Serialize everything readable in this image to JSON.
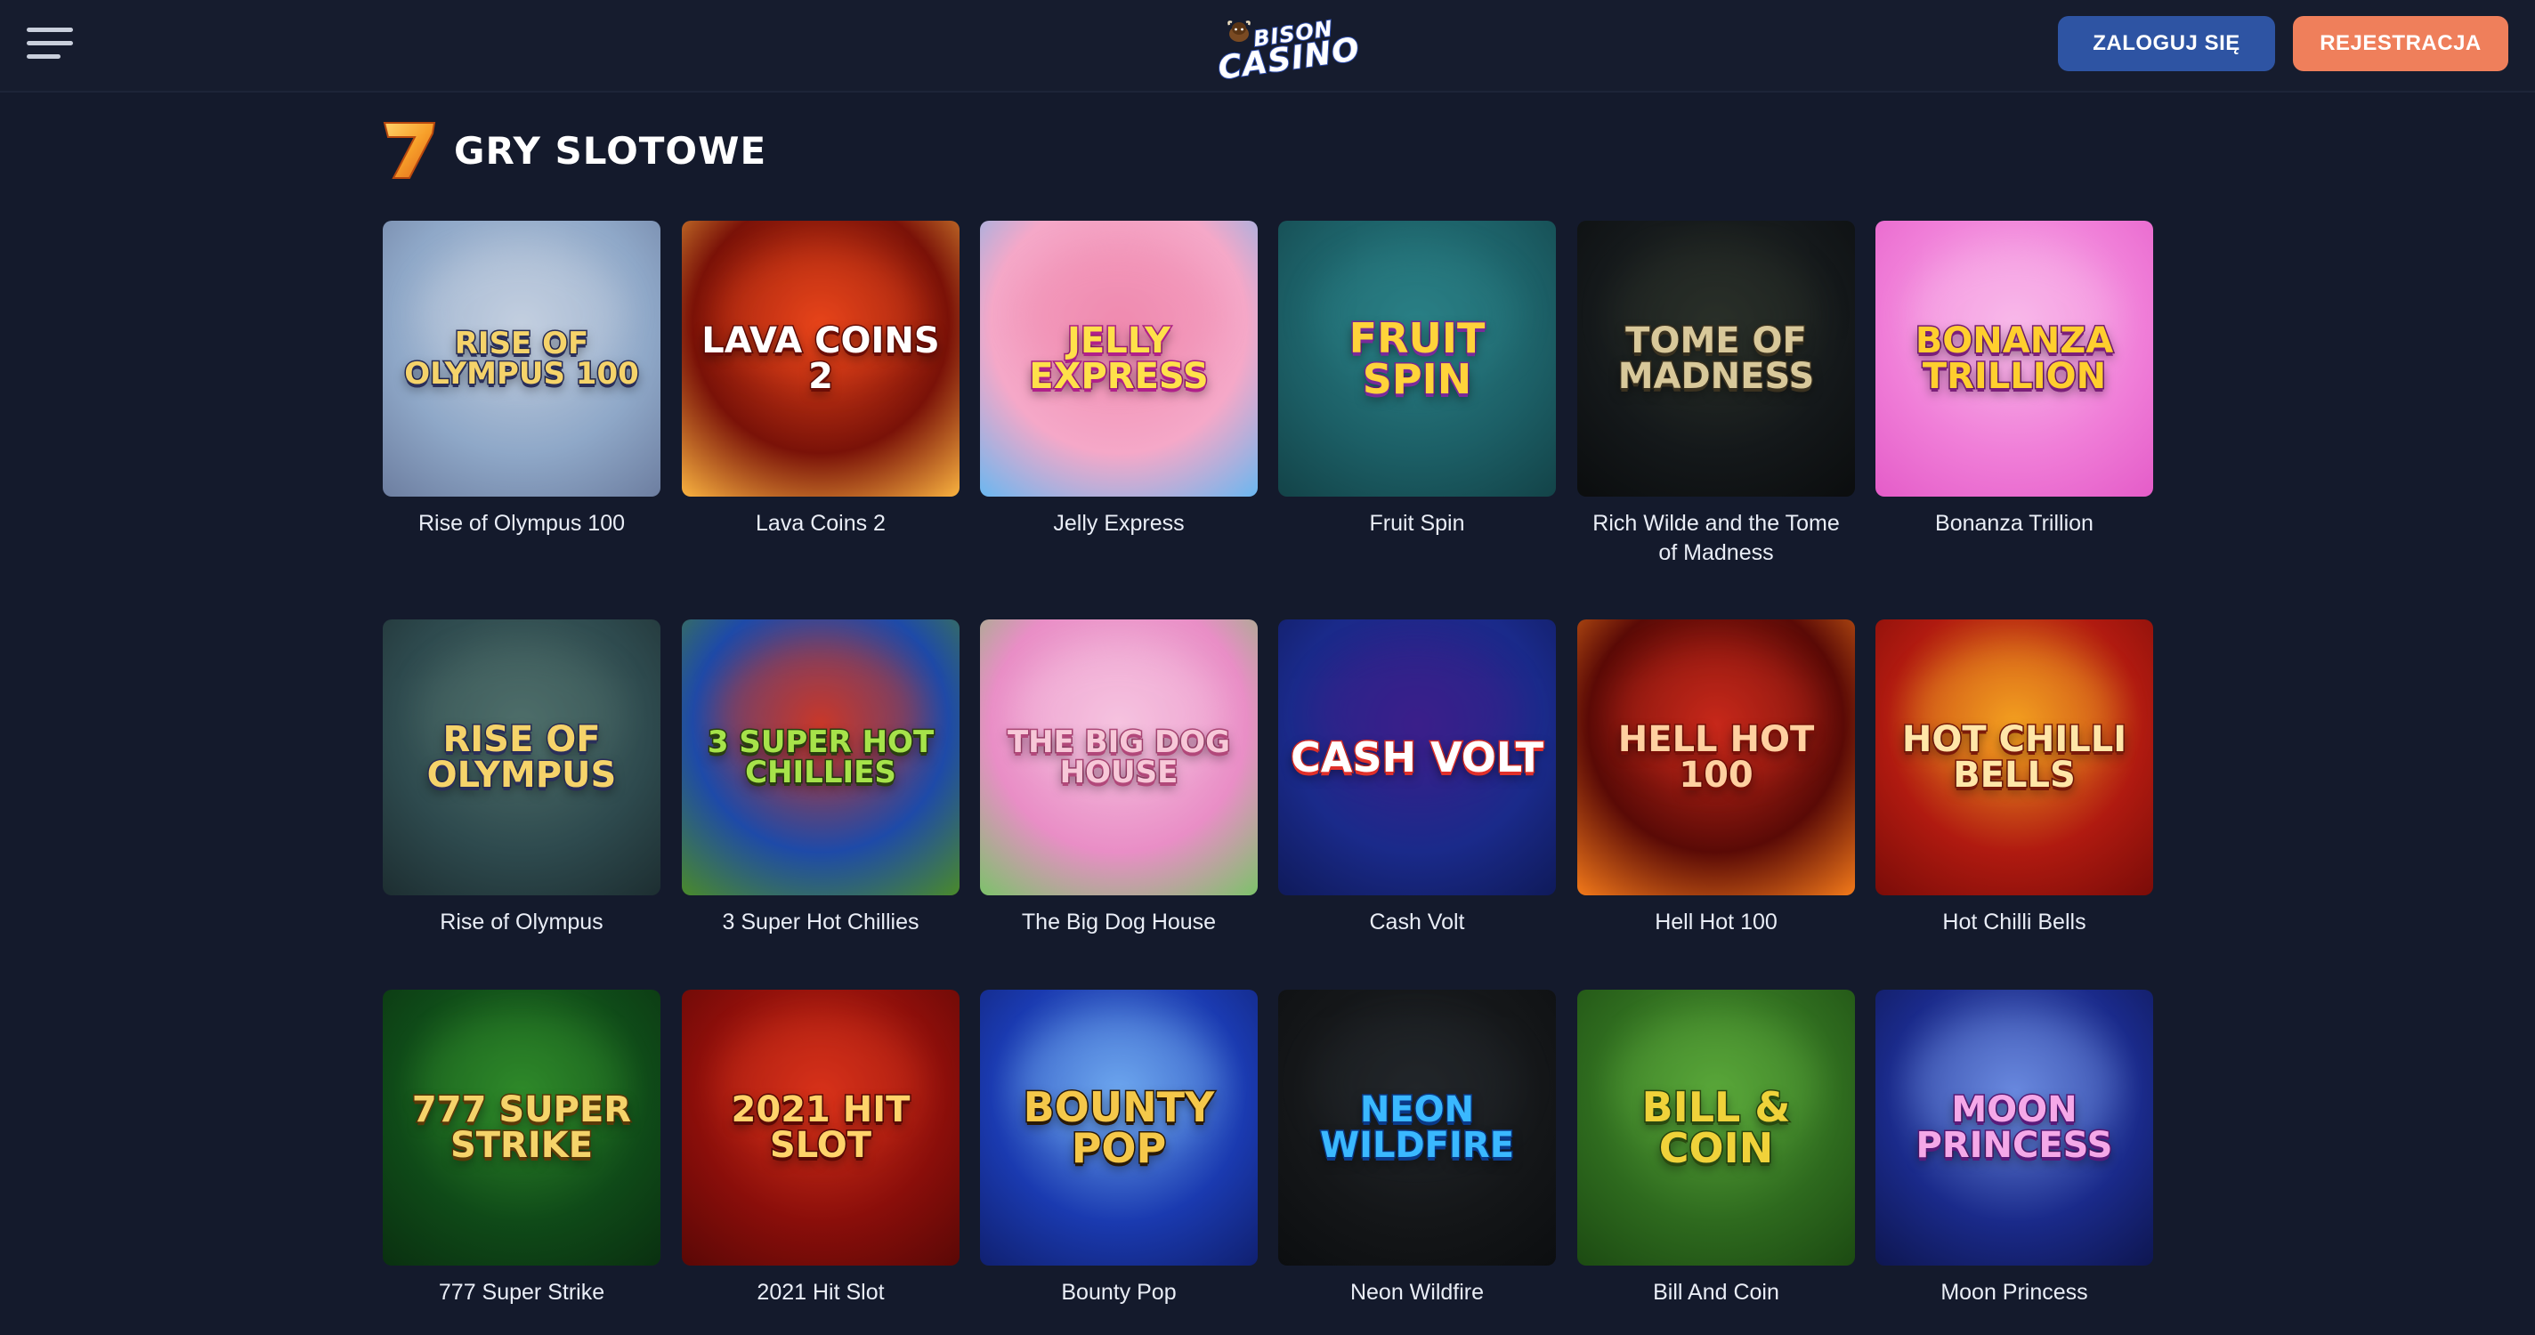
{
  "header": {
    "logo_top": "BISON",
    "logo_bottom": "CASINO",
    "login_label": "ZALOGUJ SIĘ",
    "register_label": "REJESTRACJA"
  },
  "section": {
    "title": "GRY SLOTOWE"
  },
  "games": [
    {
      "name": "Rise of Olympus 100",
      "art": "RISE OF OLYMPUS 100",
      "colors": [
        "#8fa8c8",
        "#c3cfe0",
        "#6d7ea0"
      ],
      "ink": "#f5d36a",
      "stroke": "#2a2f5a"
    },
    {
      "name": "Lava Coins 2",
      "art": "LAVA COINS 2",
      "colors": [
        "#7a1208",
        "#e8441a",
        "#f9b340"
      ],
      "ink": "#ffffff",
      "stroke": "#6b0d06"
    },
    {
      "name": "Jelly Express",
      "art": "JELLY EXPRESS",
      "colors": [
        "#f5a8c8",
        "#f08bb0",
        "#6ab7f0"
      ],
      "ink": "#ffe14a",
      "stroke": "#b0208a"
    },
    {
      "name": "Fruit Spin",
      "art": "FRUIT SPIN",
      "colors": [
        "#1c5f66",
        "#2a8086",
        "#134348"
      ],
      "ink": "#ffd33a",
      "stroke": "#7a2a9a"
    },
    {
      "name": "Rich Wilde and the Tome of Madness",
      "art": "TOME OF MADNESS",
      "colors": [
        "#14181a",
        "#2a3029",
        "#0b0d0e"
      ],
      "ink": "#d8c89a",
      "stroke": "#3b3220"
    },
    {
      "name": "Bonanza Trillion",
      "art": "BONANZA TRILLION",
      "colors": [
        "#f07ed8",
        "#f9b9ea",
        "#e45cc8"
      ],
      "ink": "#ffcf2e",
      "stroke": "#7b1f7a"
    },
    {
      "name": "Rise of Olympus",
      "art": "RISE OF OLYMPUS",
      "colors": [
        "#2e4a4e",
        "#4e6e6a",
        "#1d2e31"
      ],
      "ink": "#f5d36a",
      "stroke": "#2a2f5a"
    },
    {
      "name": "3 Super Hot Chillies",
      "art": "3 SUPER HOT CHILLIES",
      "colors": [
        "#1e4aa8",
        "#c9382a",
        "#4a8a2a"
      ],
      "ink": "#a6e34a",
      "stroke": "#2a3f10"
    },
    {
      "name": "The Big Dog House",
      "art": "THE BIG DOG HOUSE",
      "colors": [
        "#e98ec6",
        "#f6c3e0",
        "#7cc26a"
      ],
      "ink": "#f7c8d8",
      "stroke": "#b2487a"
    },
    {
      "name": "Cash Volt",
      "art": "CASH VOLT",
      "colors": [
        "#1a2a8a",
        "#3b1f8a",
        "#0f1a5a"
      ],
      "ink": "#ffffff",
      "stroke": "#e0302a"
    },
    {
      "name": "Hell Hot 100",
      "art": "HELL HOT 100",
      "colors": [
        "#5a0a06",
        "#c7281a",
        "#f37a1a"
      ],
      "ink": "#ffd0a0",
      "stroke": "#7a1008"
    },
    {
      "name": "Hot Chilli Bells",
      "art": "HOT CHILLI BELLS",
      "colors": [
        "#b01a10",
        "#f4a020",
        "#7a0c08"
      ],
      "ink": "#ffe6a8",
      "stroke": "#7a1a0a"
    },
    {
      "name": "777 Super Strike",
      "art": "777 SUPER STRIKE",
      "colors": [
        "#0f4a18",
        "#2f8a2a",
        "#0a3010"
      ],
      "ink": "#f5d36a",
      "stroke": "#5a3a08"
    },
    {
      "name": "2021 Hit Slot",
      "art": "2021 HIT SLOT",
      "colors": [
        "#8a0e0a",
        "#d8321a",
        "#5a0806"
      ],
      "ink": "#ffd36a",
      "stroke": "#5a0a06"
    },
    {
      "name": "Bounty Pop",
      "art": "BOUNTY POP",
      "colors": [
        "#1a3ab0",
        "#6ea8f0",
        "#102070"
      ],
      "ink": "#f5c84a",
      "stroke": "#2a1a08"
    },
    {
      "name": "Neon Wildfire",
      "art": "NEON WILDFIRE",
      "colors": [
        "#141618",
        "#22262a",
        "#0c0e10"
      ],
      "ink": "#3ab8ff",
      "stroke": "#0a3a8a"
    },
    {
      "name": "Bill And Coin",
      "art": "BILL & COIN",
      "colors": [
        "#2e6a1e",
        "#5aa83a",
        "#1c4a12"
      ],
      "ink": "#f0d23a",
      "stroke": "#2a4a10"
    },
    {
      "name": "Moon Princess",
      "art": "MOON PRINCESS",
      "colors": [
        "#1a2a8a",
        "#6a8ae0",
        "#0e1650"
      ],
      "ink": "#f5a8e8",
      "stroke": "#5a1a7a"
    }
  ]
}
